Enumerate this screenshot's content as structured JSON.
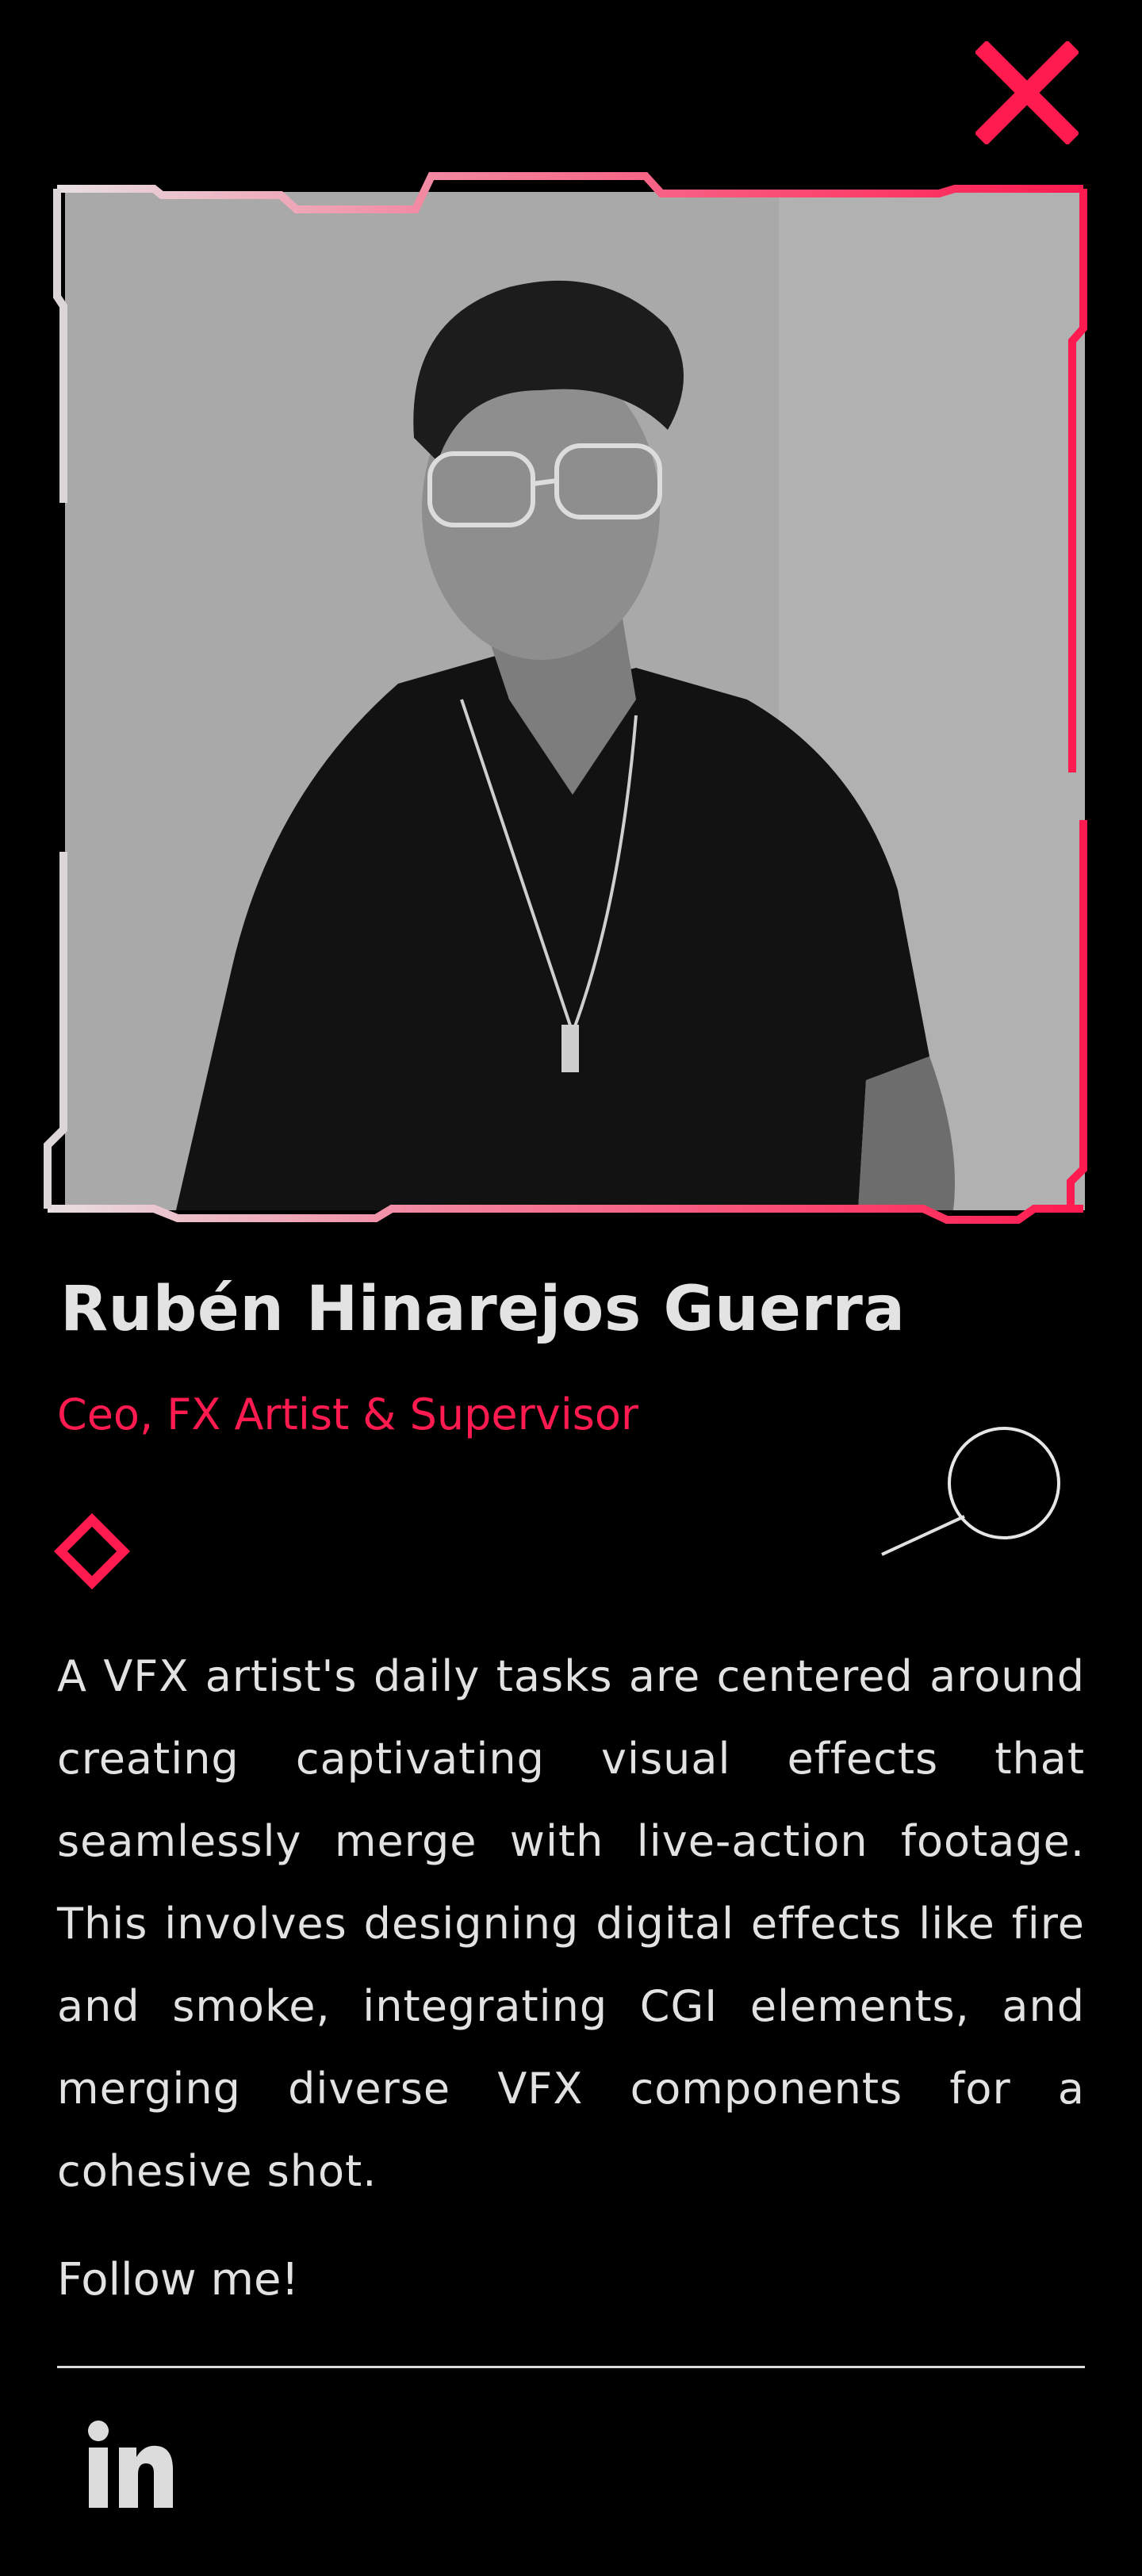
{
  "profile": {
    "name": "Rubén Hinarejos Guerra",
    "role": "Ceo, FX Artist & Supervisor",
    "bio": "A VFX artist's daily tasks are centered around creating captivating visual effects that seamlessly merge with live-action footage. This involves designing digital effects like fire and smoke, integrating CGI elements, and merging diverse VFX components for a cohesive shot.",
    "follow_label": "Follow me!"
  },
  "icons": {
    "close": "close-icon",
    "linkedin": "linkedin-icon",
    "diamond": "diamond-icon",
    "circle": "circle-icon"
  },
  "colors": {
    "background": "#000000",
    "accent": "#ff1a4f",
    "text": "#e2e2e2",
    "frame_light": "#f2c9d3"
  }
}
